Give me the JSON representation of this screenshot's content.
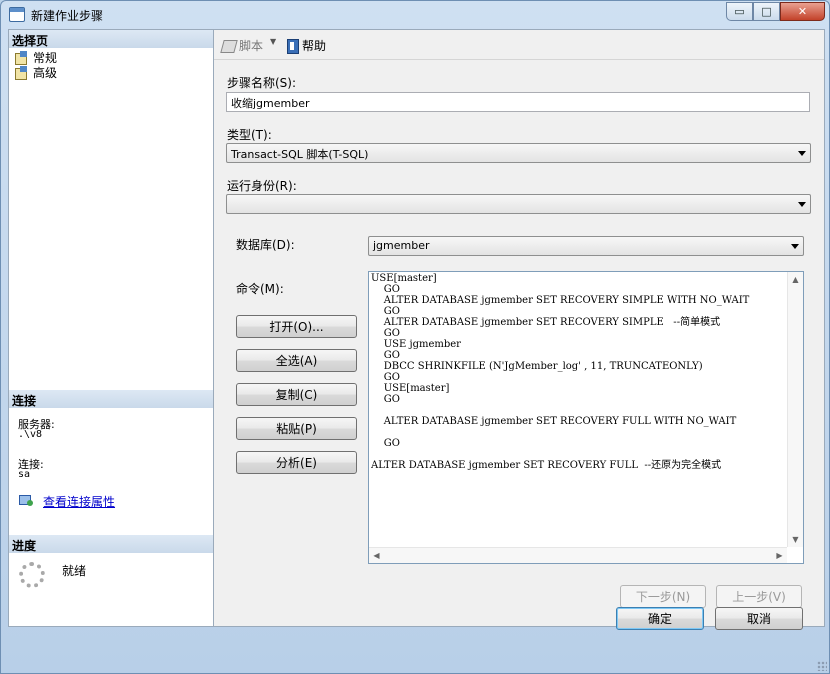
{
  "window": {
    "title": "新建作业步骤",
    "controls": {
      "minimize": "▭",
      "maximize": "□",
      "close": "✕"
    }
  },
  "left": {
    "select_page_header": "选择页",
    "nav_items": [
      {
        "label": "常规",
        "icon": "page-general-icon"
      },
      {
        "label": "高级",
        "icon": "page-advanced-icon"
      }
    ],
    "connection_header": "连接",
    "server_label": "服务器:",
    "server_value": ".\\v8",
    "connection_label": "连接:",
    "connection_value": "sa",
    "view_connection_link": "查看连接属性",
    "progress_header": "进度",
    "progress_status": "就绪"
  },
  "toolbar": {
    "script_label": "脚本",
    "help_label": "帮助"
  },
  "form": {
    "step_name_label": "步骤名称(S):",
    "step_name_value": "收缩jgmember",
    "type_label": "类型(T):",
    "type_value": "Transact-SQL 脚本(T-SQL)",
    "run_as_label": "运行身份(R):",
    "run_as_value": "",
    "database_label": "数据库(D):",
    "database_value": "jgmember",
    "command_label": "命令(M):",
    "buttons": {
      "open": "打开(O)...",
      "select_all": "全选(A)",
      "copy": "复制(C)",
      "paste": "粘贴(P)",
      "parse": "分析(E)"
    },
    "command_text": "USE[master]\n    GO\n    ALTER DATABASE jgmember SET RECOVERY SIMPLE WITH NO_WAIT\n    GO\n    ALTER DATABASE jgmember SET RECOVERY SIMPLE   --简单模式\n    GO\n    USE jgmember\n    GO\n    DBCC SHRINKFILE (N'JgMember_log' , 11, TRUNCATEONLY)\n    GO\n    USE[master]\n    GO\n\n    ALTER DATABASE jgmember SET RECOVERY FULL WITH NO_WAIT\n\n    GO\n\nALTER DATABASE jgmember SET RECOVERY FULL  --还原为完全模式",
    "next_button": "下一步(N)",
    "prev_button": "上一步(V)"
  },
  "footer": {
    "ok_button": "确定",
    "cancel_button": "取消"
  }
}
